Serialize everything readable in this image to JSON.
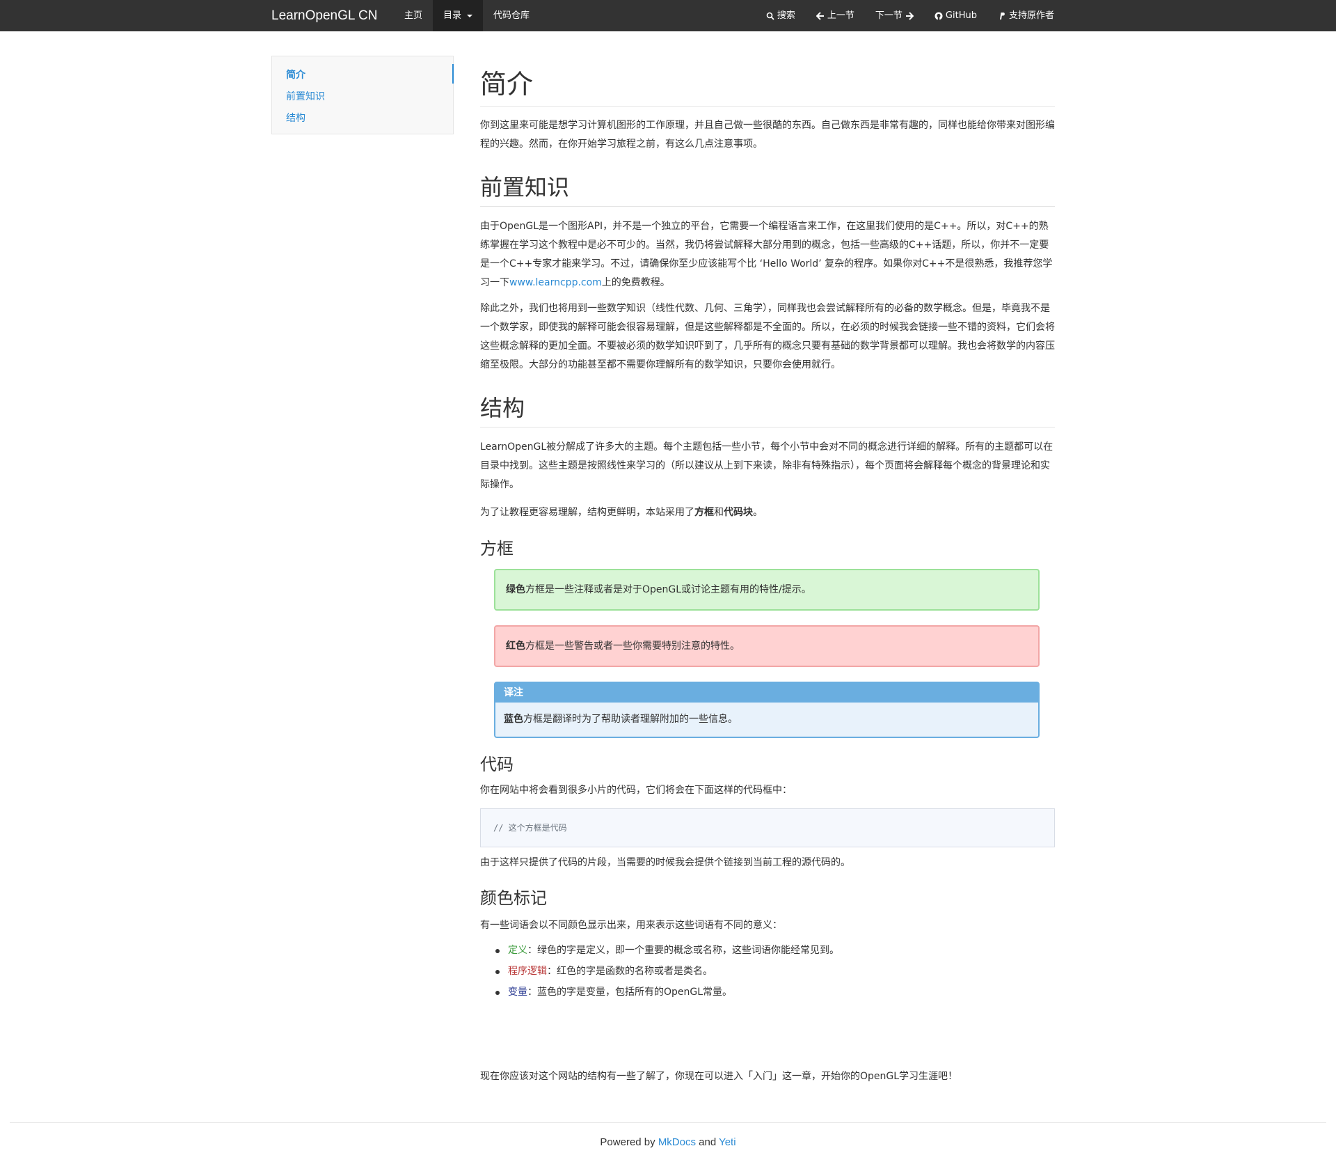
{
  "navbar": {
    "brand": "LearnOpenGL CN",
    "left_items": [
      "主页",
      "目录",
      "代码仓库"
    ],
    "right_items": [
      {
        "icon": "search-icon",
        "label": "搜索"
      },
      {
        "icon": "arrow-left-icon",
        "label": "上一节"
      },
      {
        "icon": "arrow-right-icon",
        "label": "下一节"
      },
      {
        "icon": "github-icon",
        "label": "GitHub"
      },
      {
        "icon": "paypal-icon",
        "label": "支持原作者"
      }
    ]
  },
  "sidebar": {
    "items": [
      "简介",
      "前置知识",
      "结构"
    ]
  },
  "content": {
    "title": "简介",
    "intro": "你到这里来可能是想学习计算机图形的工作原理，并且自己做一些很酷的东西。自己做东西是非常有趣的，同样也能给你带来对图形编程的兴趣。然而，在你开始学习旅程之前，有这么几点注意事项。",
    "prereq_title": "前置知识",
    "prereq_p1_before": "由于OpenGL是一个图形API，并不是一个独立的平台，它需要一个编程语言来工作，在这里我们使用的是C++。所以，对C++的熟练掌握在学习这个教程中是必不可少的。当然，我仍将尝试解释大部分用到的概念，包括一些高级的C++话题，所以，你并不一定要是一个C++专家才能来学习。不过，请确保你至少应该能写个比 ‘Hello World’ 复杂的程序。如果你对C++不是很熟悉，我推荐您学习一下",
    "prereq_p1_link": "www.learncpp.com",
    "prereq_p1_after": "上的免费教程。",
    "prereq_p2": "除此之外，我们也将用到一些数学知识（线性代数、几何、三角学），同样我也会尝试解释所有的必备的数学概念。但是，毕竟我不是一个数学家，即使我的解释可能会很容易理解，但是这些解释都是不全面的。所以，在必须的时候我会链接一些不错的资料，它们会将这些概念解释的更加全面。不要被必须的数学知识吓到了，几乎所有的概念只要有基础的数学背景都可以理解。我也会将数学的内容压缩至极限。大部分的功能甚至都不需要你理解所有的数学知识，只要你会使用就行。",
    "structure_title": "结构",
    "structure_p1": "LearnOpenGL被分解成了许多大的主题。每个主题包括一些小节，每个小节中会对不同的概念进行详细的解释。所有的主题都可以在目录中找到。这些主题是按照线性来学习的（所以建议从上到下来读，除非有特殊指示），每个页面将会解释每个概念的背景理论和实际操作。",
    "structure_p2_before": "为了让教程更容易理解，结构更鲜明，本站采用了",
    "structure_p2_bold1": "方框",
    "structure_p2_mid": "和",
    "structure_p2_bold2": "代码块",
    "structure_p2_after": "。",
    "boxes_title": "方框",
    "green_box_bold": "绿色",
    "green_box_text": "方框是一些注释或者是对于OpenGL或讨论主题有用的特性/提示。",
    "red_box_bold": "红色",
    "red_box_text": "方框是一些警告或者一些你需要特别注意的特性。",
    "blue_box_head": "译注",
    "blue_box_bold": "蓝色",
    "blue_box_text": "方框是翻译时为了帮助读者理解附加的一些信息。",
    "code_title": "代码",
    "code_p1": "你在网站中将会看到很多小片的代码，它们将会在下面这样的代码框中：",
    "code_sample": "// 这个方框是代码",
    "code_p2": "由于这样只提供了代码的片段，当需要的时候我会提供个链接到当前工程的源代码的。",
    "color_title": "颜色标记",
    "color_p1": "有一些词语会以不同颜色显示出来，用来表示这些词语有不同的意义：",
    "color_items": [
      {
        "term": "定义",
        "desc": "：绿色的字是定义，即一个重要的概念或名称，这些词语你能经常见到。"
      },
      {
        "term": "程序逻辑",
        "desc": "：红色的字是函数的名称或者是类名。"
      },
      {
        "term": "变量",
        "desc": "：蓝色的字是变量，包括所有的OpenGL常量。"
      }
    ],
    "closing": "现在你应该对这个网站的结构有一些了解了，你现在可以进入「入门」这一章，开始你的OpenGL学习生涯吧！"
  },
  "footer": {
    "prefix": "Powered by ",
    "link1": "MkDocs",
    "mid": " and ",
    "link2": "Yeti"
  },
  "colors": {
    "navbar_bg": "#333333",
    "link": "#2a8ad4",
    "green_box": "#d9f6d6",
    "red_box": "#ffd2d2",
    "blue_box_head": "#6aaee0"
  }
}
